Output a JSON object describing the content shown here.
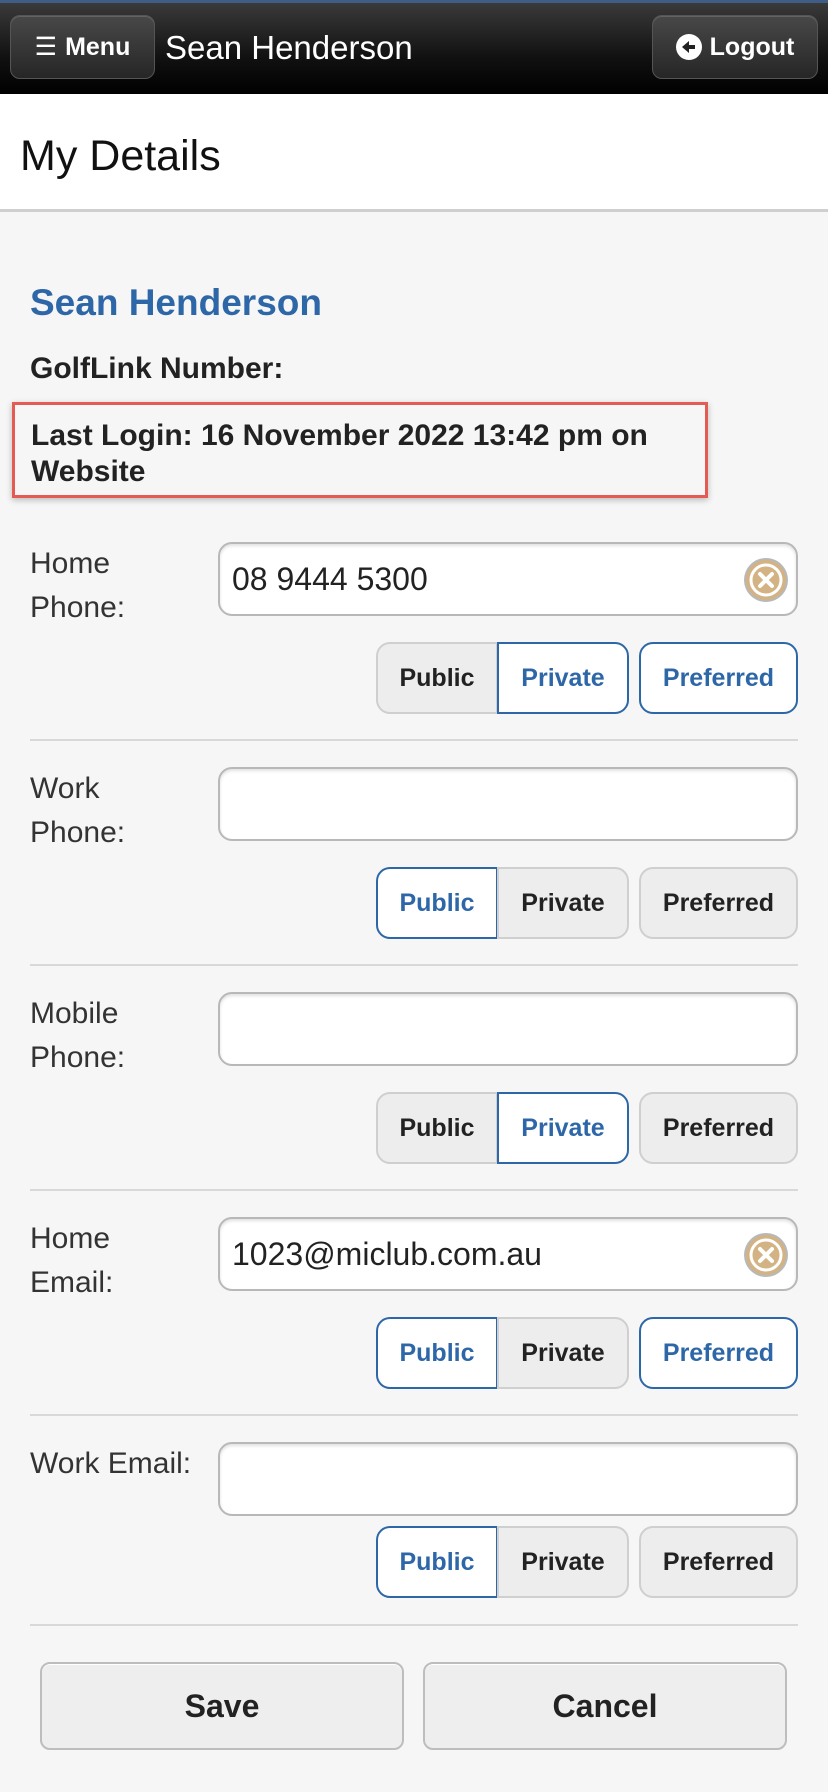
{
  "header": {
    "menu_label": "Menu",
    "title": "Sean Henderson",
    "logout_label": "Logout"
  },
  "page_title": "My Details",
  "member": {
    "name": "Sean Henderson",
    "golflink": "GolfLink Number:",
    "last_login": "Last Login: 16 November 2022 13:42 pm on Website"
  },
  "fields": [
    {
      "label": "Home Phone:",
      "value": "08 9444 5300",
      "selected": "Private",
      "preferred": true
    },
    {
      "label": "Work Phone:",
      "value": "",
      "selected": "Public",
      "preferred": false
    },
    {
      "label": "Mobile Phone:",
      "value": "",
      "selected": "Private",
      "preferred": false
    },
    {
      "label": "Home Email:",
      "value": "1023@miclub.com.au",
      "selected": "Public",
      "preferred": true
    },
    {
      "label": "Work Email:",
      "value": "",
      "selected": "Public",
      "preferred": false
    }
  ],
  "options": {
    "public": "Public",
    "private": "Private",
    "preferred": "Preferred"
  },
  "actions": {
    "save": "Save",
    "cancel": "Cancel"
  },
  "colors": {
    "accent": "#2e67a7",
    "highlight_border": "#e35b53"
  },
  "icons": [
    "menu-icon",
    "logout-icon",
    "clear-icon"
  ]
}
